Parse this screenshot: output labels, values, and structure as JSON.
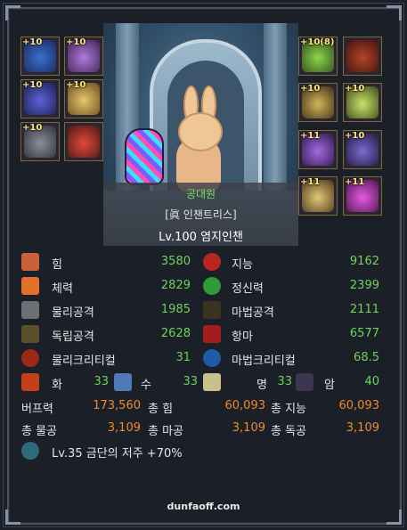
{
  "character": {
    "guild": "공대원",
    "title": "[眞 인챈트리스]",
    "level_name": "Lv.100 염지인챈"
  },
  "equipment": {
    "left": [
      {
        "plus": "+10",
        "icon": "blue-rabbit-hat-icon"
      },
      {
        "plus": "+10",
        "icon": "purple-dress-icon"
      },
      {
        "plus": "+10",
        "icon": "blue-shoulder-icon"
      },
      {
        "plus": "+10",
        "icon": "golden-belt-icon"
      },
      {
        "plus": "+10",
        "icon": "dark-boots-icon"
      },
      {
        "plus": "",
        "icon": "red-creature-icon"
      }
    ],
    "right": [
      {
        "plus": "+10(8)",
        "icon": "green-weapon-icon"
      },
      {
        "plus": "",
        "icon": "red-title-icon"
      },
      {
        "plus": "+10",
        "icon": "golden-bracelet-icon"
      },
      {
        "plus": "+10",
        "icon": "golden-sword-icon"
      },
      {
        "plus": "+11",
        "icon": "purple-ring-icon"
      },
      {
        "plus": "+10",
        "icon": "dark-ring-icon"
      },
      {
        "plus": "+11",
        "icon": "golden-cross-icon"
      },
      {
        "plus": "+11",
        "icon": "purple-gem-icon"
      }
    ]
  },
  "stats": {
    "str": {
      "label": "힘",
      "value": "3580",
      "icon": "fist-icon"
    },
    "int": {
      "label": "지능",
      "value": "9162",
      "icon": "red-eye-icon"
    },
    "vit": {
      "label": "체력",
      "value": "2829",
      "icon": "body-icon"
    },
    "spr": {
      "label": "정신력",
      "value": "2399",
      "icon": "green-eye-icon"
    },
    "patk": {
      "label": "물리공격",
      "value": "1985",
      "icon": "sword-icon"
    },
    "matk": {
      "label": "마법공격",
      "value": "2111",
      "icon": "magic-star-icon"
    },
    "iatk": {
      "label": "독립공격",
      "value": "2628",
      "icon": "independent-sword-icon"
    },
    "anti": {
      "label": "항마",
      "value": "6577",
      "icon": "anti-magic-icon"
    },
    "pcrit": {
      "label": "물리크리티컬",
      "value": "31",
      "icon": "red-target-icon"
    },
    "mcrit": {
      "label": "마법크리티컬",
      "value": "68.5",
      "icon": "blue-target-icon"
    }
  },
  "elements": [
    {
      "label": "화",
      "value": "33",
      "icon": "fire-icon"
    },
    {
      "label": "수",
      "value": "33",
      "icon": "water-icon"
    },
    {
      "label": "명",
      "value": "33",
      "icon": "light-icon"
    },
    {
      "label": "암",
      "value": "40",
      "icon": "dark-icon"
    }
  ],
  "buff": {
    "label": "버프력",
    "value": "173,560"
  },
  "totals": [
    {
      "label": "총 힘",
      "value": "60,093"
    },
    {
      "label": "총 지능",
      "value": "60,093"
    },
    {
      "label": "총 물공",
      "value": "3,109"
    },
    {
      "label": "총 마공",
      "value": "3,109"
    },
    {
      "label": "총 독공",
      "value": "3,109"
    }
  ],
  "curse": {
    "text": "Lv.35 금단의 저주 +70%",
    "icon": "curse-gear-icon"
  },
  "footer": "dunfaoff.com",
  "colors": {
    "stat_value": "#6fd35c",
    "total_value": "#f08a2c",
    "guild": "#6be06a",
    "background": "#1b1f28"
  }
}
